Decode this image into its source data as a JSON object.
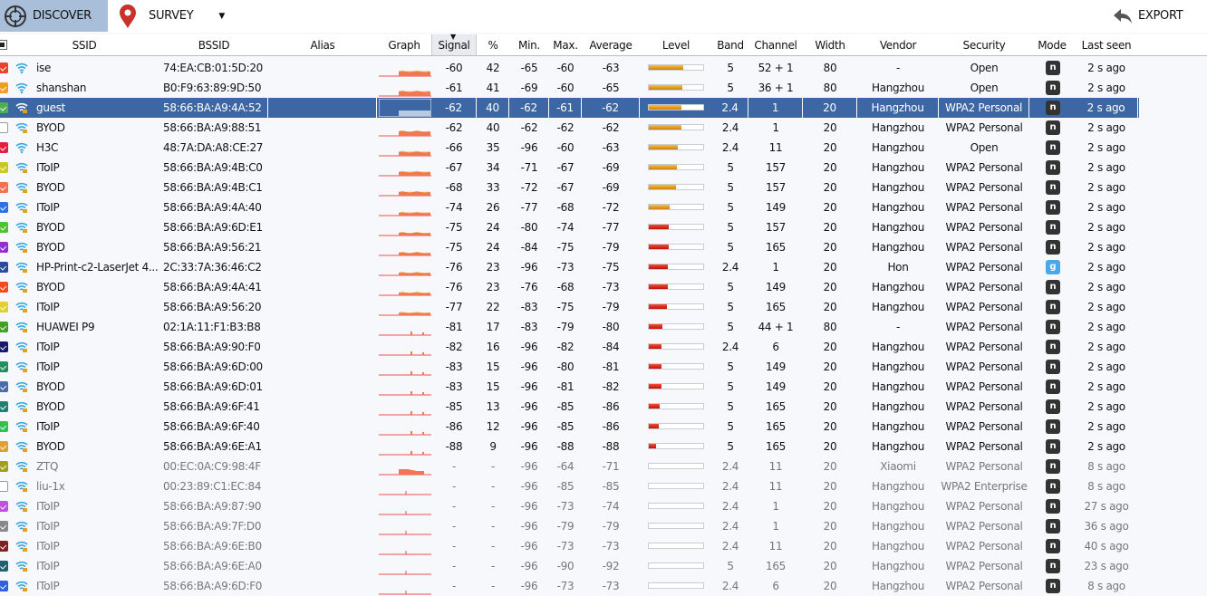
{
  "toolbar": {
    "discover": "DISCOVER",
    "survey": "SURVEY",
    "export": "EXPORT"
  },
  "columns": [
    "SSID",
    "BSSID",
    "Alias",
    "Graph",
    "Signal",
    "%",
    "Min.",
    "Max.",
    "Average",
    "Level",
    "Band",
    "Channel",
    "Width",
    "Vendor",
    "Security",
    "Mode",
    "Last seen"
  ],
  "sorted_column": "Signal",
  "rows": [
    {
      "color": "#e8442c",
      "checked": true,
      "locked": false,
      "ssid": "ise",
      "bssid": "74:EA:CB:01:5D:20",
      "alias": "",
      "signal": "-60",
      "pct": "42",
      "min": "-65",
      "max": "-60",
      "avg": "-63",
      "level": 42,
      "band": "5",
      "channel": "52 + 1",
      "width": "80",
      "vendor": "-",
      "security": "Open",
      "mode": "n",
      "last": "2 s ago",
      "active": true
    },
    {
      "color": "#f0a020",
      "checked": true,
      "locked": false,
      "ssid": "shanshan",
      "bssid": "B0:F9:63:89:9D:50",
      "alias": "",
      "signal": "-61",
      "pct": "41",
      "min": "-69",
      "max": "-60",
      "avg": "-65",
      "level": 41,
      "band": "5",
      "channel": "36 + 1",
      "width": "80",
      "vendor": "Hangzhou",
      "security": "Open",
      "mode": "n",
      "last": "2 s ago",
      "active": true
    },
    {
      "color": "#4caf50",
      "checked": true,
      "locked": true,
      "ssid": "guest",
      "bssid": "58:66:BA:A9:4A:52",
      "alias": "",
      "signal": "-62",
      "pct": "40",
      "min": "-62",
      "max": "-61",
      "avg": "-62",
      "level": 40,
      "band": "2.4",
      "channel": "1",
      "width": "20",
      "vendor": "Hangzhou",
      "security": "WPA2 Personal",
      "mode": "n",
      "last": "2 s ago",
      "active": true,
      "selected": true
    },
    {
      "color": "#ffffff",
      "checked": false,
      "locked": true,
      "ssid": "BYOD",
      "bssid": "58:66:BA:A9:88:51",
      "alias": "",
      "signal": "-62",
      "pct": "40",
      "min": "-62",
      "max": "-62",
      "avg": "-62",
      "level": 40,
      "band": "2.4",
      "channel": "1",
      "width": "20",
      "vendor": "Hangzhou",
      "security": "WPA2 Personal",
      "mode": "n",
      "last": "2 s ago",
      "active": true
    },
    {
      "color": "#e02040",
      "checked": true,
      "locked": false,
      "ssid": "H3C",
      "bssid": "48:7A:DA:A8:CE:27",
      "alias": "",
      "signal": "-66",
      "pct": "35",
      "min": "-96",
      "max": "-60",
      "avg": "-63",
      "level": 35,
      "band": "2.4",
      "channel": "11",
      "width": "20",
      "vendor": "Hangzhou",
      "security": "Open",
      "mode": "n",
      "last": "2 s ago",
      "active": true
    },
    {
      "color": "#c8c820",
      "checked": true,
      "locked": true,
      "ssid": "IToIP",
      "bssid": "58:66:BA:A9:4B:C0",
      "alias": "",
      "signal": "-67",
      "pct": "34",
      "min": "-71",
      "max": "-67",
      "avg": "-69",
      "level": 34,
      "band": "5",
      "channel": "157",
      "width": "20",
      "vendor": "Hangzhou",
      "security": "WPA2 Personal",
      "mode": "n",
      "last": "2 s ago",
      "active": true
    },
    {
      "color": "#f07050",
      "checked": true,
      "locked": true,
      "ssid": "BYOD",
      "bssid": "58:66:BA:A9:4B:C1",
      "alias": "",
      "signal": "-68",
      "pct": "33",
      "min": "-72",
      "max": "-67",
      "avg": "-69",
      "level": 33,
      "band": "5",
      "channel": "157",
      "width": "20",
      "vendor": "Hangzhou",
      "security": "WPA2 Personal",
      "mode": "n",
      "last": "2 s ago",
      "active": true
    },
    {
      "color": "#3070e0",
      "checked": true,
      "locked": true,
      "ssid": "IToIP",
      "bssid": "58:66:BA:A9:4A:40",
      "alias": "",
      "signal": "-74",
      "pct": "26",
      "min": "-77",
      "max": "-68",
      "avg": "-72",
      "level": 26,
      "band": "5",
      "channel": "149",
      "width": "20",
      "vendor": "Hangzhou",
      "security": "WPA2 Personal",
      "mode": "n",
      "last": "2 s ago",
      "active": true
    },
    {
      "color": "#50c030",
      "checked": true,
      "locked": true,
      "ssid": "BYOD",
      "bssid": "58:66:BA:A9:6D:E1",
      "alias": "",
      "signal": "-75",
      "pct": "24",
      "min": "-80",
      "max": "-74",
      "avg": "-77",
      "level": 24,
      "band": "5",
      "channel": "157",
      "width": "20",
      "vendor": "Hangzhou",
      "security": "WPA2 Personal",
      "mode": "n",
      "last": "2 s ago",
      "active": true
    },
    {
      "color": "#9030d0",
      "checked": true,
      "locked": true,
      "ssid": "BYOD",
      "bssid": "58:66:BA:A9:56:21",
      "alias": "",
      "signal": "-75",
      "pct": "24",
      "min": "-84",
      "max": "-75",
      "avg": "-79",
      "level": 24,
      "band": "5",
      "channel": "165",
      "width": "20",
      "vendor": "Hangzhou",
      "security": "WPA2 Personal",
      "mode": "n",
      "last": "2 s ago",
      "active": true
    },
    {
      "color": "#2a4a9a",
      "checked": true,
      "locked": true,
      "ssid": "HP-Print-c2-LaserJet  4...",
      "bssid": "2C:33:7A:36:46:C2",
      "alias": "",
      "signal": "-76",
      "pct": "23",
      "min": "-96",
      "max": "-73",
      "avg": "-75",
      "level": 23,
      "band": "2.4",
      "channel": "1",
      "width": "20",
      "vendor": "Hon",
      "security": "WPA2 Personal",
      "mode": "g",
      "last": "2 s ago",
      "active": true
    },
    {
      "color": "#f04a20",
      "checked": true,
      "locked": true,
      "ssid": "BYOD",
      "bssid": "58:66:BA:A9:4A:41",
      "alias": "",
      "signal": "-76",
      "pct": "23",
      "min": "-76",
      "max": "-68",
      "avg": "-73",
      "level": 23,
      "band": "5",
      "channel": "149",
      "width": "20",
      "vendor": "Hangzhou",
      "security": "WPA2 Personal",
      "mode": "n",
      "last": "2 s ago",
      "active": true
    },
    {
      "color": "#e0d030",
      "checked": true,
      "locked": true,
      "ssid": "IToIP",
      "bssid": "58:66:BA:A9:56:20",
      "alias": "",
      "signal": "-77",
      "pct": "22",
      "min": "-83",
      "max": "-75",
      "avg": "-79",
      "level": 22,
      "band": "5",
      "channel": "165",
      "width": "20",
      "vendor": "Hangzhou",
      "security": "WPA2 Personal",
      "mode": "n",
      "last": "2 s ago",
      "active": true
    },
    {
      "color": "#40a020",
      "checked": true,
      "locked": true,
      "ssid": "HUAWEI P9",
      "bssid": "02:1A:11:F1:B3:B8",
      "alias": "",
      "signal": "-81",
      "pct": "17",
      "min": "-83",
      "max": "-79",
      "avg": "-80",
      "level": 17,
      "band": "5",
      "channel": "44 + 1",
      "width": "80",
      "vendor": "-",
      "security": "WPA2 Personal",
      "mode": "n",
      "last": "2 s ago",
      "active": true
    },
    {
      "color": "#1a1a6a",
      "checked": true,
      "locked": true,
      "ssid": "IToIP",
      "bssid": "58:66:BA:A9:90:F0",
      "alias": "",
      "signal": "-82",
      "pct": "16",
      "min": "-96",
      "max": "-82",
      "avg": "-84",
      "level": 16,
      "band": "2.4",
      "channel": "6",
      "width": "20",
      "vendor": "Hangzhou",
      "security": "WPA2 Personal",
      "mode": "n",
      "last": "2 s ago",
      "active": true
    },
    {
      "color": "#209060",
      "checked": true,
      "locked": true,
      "ssid": "IToIP",
      "bssid": "58:66:BA:A9:6D:00",
      "alias": "",
      "signal": "-83",
      "pct": "15",
      "min": "-96",
      "max": "-80",
      "avg": "-81",
      "level": 15,
      "band": "5",
      "channel": "149",
      "width": "20",
      "vendor": "Hangzhou",
      "security": "WPA2 Personal",
      "mode": "n",
      "last": "2 s ago",
      "active": true
    },
    {
      "color": "#4a6aaa",
      "checked": true,
      "locked": true,
      "ssid": "BYOD",
      "bssid": "58:66:BA:A9:6D:01",
      "alias": "",
      "signal": "-83",
      "pct": "15",
      "min": "-96",
      "max": "-81",
      "avg": "-82",
      "level": 15,
      "band": "5",
      "channel": "149",
      "width": "20",
      "vendor": "Hangzhou",
      "security": "WPA2 Personal",
      "mode": "n",
      "last": "2 s ago",
      "active": true
    },
    {
      "color": "#208070",
      "checked": true,
      "locked": true,
      "ssid": "BYOD",
      "bssid": "58:66:BA:A9:6F:41",
      "alias": "",
      "signal": "-85",
      "pct": "13",
      "min": "-96",
      "max": "-85",
      "avg": "-86",
      "level": 13,
      "band": "5",
      "channel": "165",
      "width": "20",
      "vendor": "Hangzhou",
      "security": "WPA2 Personal",
      "mode": "n",
      "last": "2 s ago",
      "active": true
    },
    {
      "color": "#30c050",
      "checked": true,
      "locked": true,
      "ssid": "IToIP",
      "bssid": "58:66:BA:A9:6F:40",
      "alias": "",
      "signal": "-86",
      "pct": "12",
      "min": "-96",
      "max": "-85",
      "avg": "-86",
      "level": 12,
      "band": "5",
      "channel": "165",
      "width": "20",
      "vendor": "Hangzhou",
      "security": "WPA2 Personal",
      "mode": "n",
      "last": "2 s ago",
      "active": true
    },
    {
      "color": "#e0a030",
      "checked": true,
      "locked": true,
      "ssid": "BYOD",
      "bssid": "58:66:BA:A9:6E:A1",
      "alias": "",
      "signal": "-88",
      "pct": "9",
      "min": "-96",
      "max": "-88",
      "avg": "-88",
      "level": 9,
      "band": "5",
      "channel": "165",
      "width": "20",
      "vendor": "Hangzhou",
      "security": "WPA2 Personal",
      "mode": "n",
      "last": "2 s ago",
      "active": true
    },
    {
      "color": "#a0a020",
      "checked": true,
      "locked": true,
      "ssid": "ZTQ",
      "bssid": "00:EC:0A:C9:98:4F",
      "alias": "",
      "signal": "-",
      "pct": "-",
      "min": "-96",
      "max": "-64",
      "avg": "-71",
      "level": 0,
      "band": "2.4",
      "channel": "11",
      "width": "20",
      "vendor": "Xiaomi",
      "security": "WPA2 Personal",
      "mode": "n",
      "last": "8 s ago",
      "active": false
    },
    {
      "color": "#ffffff",
      "checked": false,
      "locked": true,
      "ssid": "liu-1x",
      "bssid": "00:23:89:C1:EC:84",
      "alias": "",
      "signal": "-",
      "pct": "-",
      "min": "-96",
      "max": "-85",
      "avg": "-85",
      "level": 0,
      "band": "2.4",
      "channel": "11",
      "width": "20",
      "vendor": "Hangzhou",
      "security": "WPA2 Enterprise",
      "mode": "n",
      "last": "8 s ago",
      "active": false
    },
    {
      "color": "#c050e0",
      "checked": true,
      "locked": true,
      "ssid": "IToIP",
      "bssid": "58:66:BA:A9:87:90",
      "alias": "",
      "signal": "-",
      "pct": "-",
      "min": "-96",
      "max": "-73",
      "avg": "-74",
      "level": 0,
      "band": "2.4",
      "channel": "1",
      "width": "20",
      "vendor": "Hangzhou",
      "security": "WPA2 Personal",
      "mode": "n",
      "last": "27 s ago",
      "active": false
    },
    {
      "color": "#888888",
      "checked": true,
      "locked": true,
      "ssid": "IToIP",
      "bssid": "58:66:BA:A9:7F:D0",
      "alias": "",
      "signal": "-",
      "pct": "-",
      "min": "-96",
      "max": "-79",
      "avg": "-79",
      "level": 0,
      "band": "2.4",
      "channel": "1",
      "width": "20",
      "vendor": "Hangzhou",
      "security": "WPA2 Personal",
      "mode": "n",
      "last": "36 s ago",
      "active": false
    },
    {
      "color": "#802020",
      "checked": true,
      "locked": true,
      "ssid": "IToIP",
      "bssid": "58:66:BA:A9:6E:B0",
      "alias": "",
      "signal": "-",
      "pct": "-",
      "min": "-96",
      "max": "-73",
      "avg": "-73",
      "level": 0,
      "band": "2.4",
      "channel": "11",
      "width": "20",
      "vendor": "Hangzhou",
      "security": "WPA2 Personal",
      "mode": "n",
      "last": "40 s ago",
      "active": false
    },
    {
      "color": "#206070",
      "checked": true,
      "locked": true,
      "ssid": "IToIP",
      "bssid": "58:66:BA:A9:6E:A0",
      "alias": "",
      "signal": "-",
      "pct": "-",
      "min": "-96",
      "max": "-90",
      "avg": "-92",
      "level": 0,
      "band": "5",
      "channel": "165",
      "width": "20",
      "vendor": "Hangzhou",
      "security": "WPA2 Personal",
      "mode": "n",
      "last": "23 s ago",
      "active": false
    },
    {
      "color": "#3060e0",
      "checked": true,
      "locked": true,
      "ssid": "IToIP",
      "bssid": "58:66:BA:A9:6D:F0",
      "alias": "",
      "signal": "-",
      "pct": "-",
      "min": "-96",
      "max": "-73",
      "avg": "-73",
      "level": 0,
      "band": "2.4",
      "channel": "6",
      "width": "20",
      "vendor": "Hangzhou",
      "security": "WPA2 Personal",
      "mode": "n",
      "last": "8 s ago",
      "active": false
    }
  ]
}
